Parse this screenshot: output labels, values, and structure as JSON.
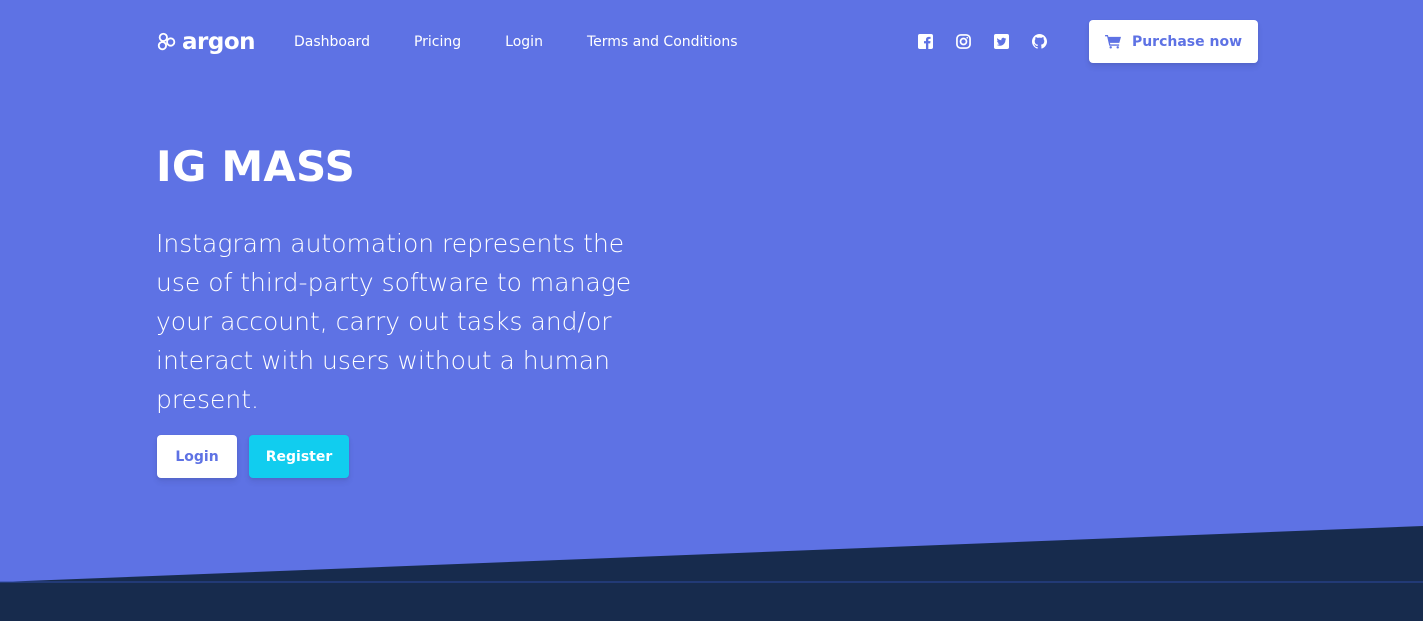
{
  "brand": {
    "name": "argon",
    "icon": "argon-logo-icon"
  },
  "nav": {
    "links": [
      "Dashboard",
      "Pricing",
      "Login",
      "Terms and Conditions"
    ]
  },
  "social": [
    {
      "name": "facebook-icon"
    },
    {
      "name": "instagram-icon"
    },
    {
      "name": "twitter-icon"
    },
    {
      "name": "github-icon"
    }
  ],
  "purchase": {
    "label": "Purchase now",
    "icon": "cart-icon"
  },
  "hero": {
    "title": "IG MASS",
    "lead": "Instagram automation represents the use of third-party software to manage your account, carry out tasks and/or interact with users without a human present.",
    "login_label": "Login",
    "register_label": "Register"
  },
  "colors": {
    "primary": "#5e72e4",
    "info": "#11cdef",
    "dark_section": "#172b4d",
    "white": "#ffffff"
  }
}
